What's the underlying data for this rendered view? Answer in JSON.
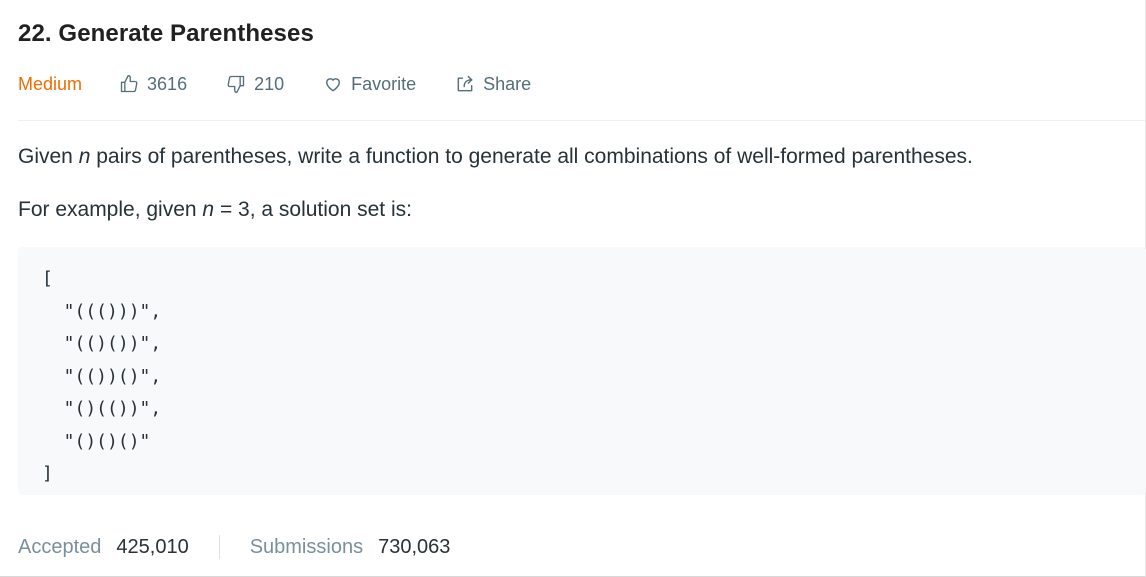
{
  "problem": {
    "title": "22. Generate Parentheses",
    "difficulty": "Medium",
    "likes": "3616",
    "dislikes": "210",
    "favorite_label": "Favorite",
    "share_label": "Share"
  },
  "description": {
    "line1_before": "Given ",
    "line1_var": "n",
    "line1_after": " pairs of parentheses, write a function to generate all combinations of well-formed parentheses.",
    "line2_before": "For example, given ",
    "line2_var": "n",
    "line2_after": " = 3, a solution set is:"
  },
  "example": {
    "lines": [
      "[",
      "  \"((()))\",",
      "  \"(()())\",",
      "  \"(())()\",",
      "  \"()(())\",",
      "  \"()()()\"",
      "]"
    ]
  },
  "stats": {
    "accepted_label": "Accepted",
    "accepted_value": "425,010",
    "submissions_label": "Submissions",
    "submissions_value": "730,063"
  },
  "colors": {
    "difficulty_medium": "#ef6c00",
    "muted_text": "#546e7a",
    "code_bg": "#f7f9fa"
  },
  "icons": {
    "like": "thumbs-up-icon",
    "dislike": "thumbs-down-icon",
    "favorite": "heart-icon",
    "share": "share-icon"
  }
}
